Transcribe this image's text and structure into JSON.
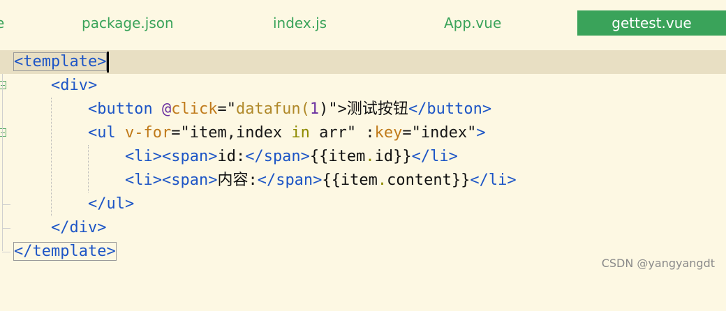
{
  "tabs": [
    {
      "label": "e"
    },
    {
      "label": "package.json"
    },
    {
      "label": "index.js"
    },
    {
      "label": "App.vue"
    },
    {
      "label": "gettest.vue",
      "active": true
    }
  ],
  "code": {
    "l1": {
      "open": "<template",
      "close": ">"
    },
    "l2": {
      "text": "<div>"
    },
    "l3": {
      "tag_open": "<button",
      "attr_at": "@",
      "attr_name": "click",
      "eq": "=\"",
      "fn": "datafun(",
      "num": "1",
      "fn_end": ")\">",
      "label": "测试按钮",
      "tag_close": "</button>"
    },
    "l4": {
      "tag_open": "<ul",
      "attr1": "v-for",
      "eq1": "=\"item,index ",
      "kw": "in",
      "rest1": " arr\" :",
      "attr2": "key",
      "eq2": "=\"index\"",
      "tag_end": ">"
    },
    "l5": {
      "li_open": "<li><span>",
      "label": "id:",
      "span_close": "</span>",
      "expr_open": "{{item",
      "dot": ".",
      "prop": "id",
      "expr_close": "}}",
      "li_close": "</li>"
    },
    "l6": {
      "li_open": "<li><span>",
      "label": "内容:",
      "span_close": "</span>",
      "expr_open": "{{item",
      "dot": ".",
      "prop": "content",
      "expr_close": "}}",
      "li_close": "</li>"
    },
    "l7": {
      "text": "</ul>"
    },
    "l8": {
      "text": "</div>"
    },
    "l9": {
      "open": "</template",
      "close": ">"
    }
  },
  "watermark": "CSDN @yangyangdt",
  "colors": {
    "accent": "#3aa35a",
    "tag": "#1d55c6",
    "background": "#fdf8e3",
    "current_line": "#e8dfc3"
  }
}
